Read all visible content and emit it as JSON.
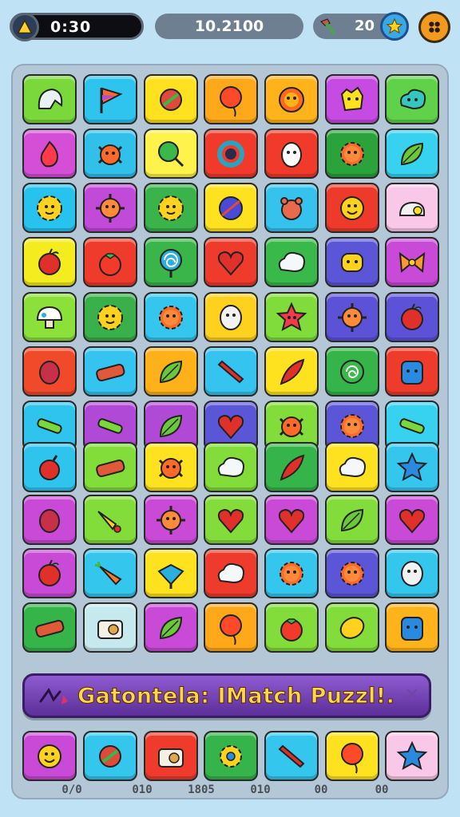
{
  "hud": {
    "timer": "0:30",
    "score": "10.2100",
    "moves": "20"
  },
  "banner": {
    "text": "Gatontela: IMatch Puzzl!."
  },
  "board": {
    "rows": [
      [
        {
          "color": "#7ad83a",
          "icon": "ghost-icon"
        },
        {
          "color": "#2fc4ee",
          "icon": "flag-icon"
        },
        {
          "color": "#ffe11f",
          "icon": "candy-icon"
        },
        {
          "color": "#ffa91a",
          "icon": "balloon-icon"
        },
        {
          "color": "#ffb31a",
          "icon": "sun-icon"
        },
        {
          "color": "#c64be2",
          "icon": "cat-icon"
        },
        {
          "color": "#5fd24a",
          "icon": "cloud-face-icon"
        }
      ],
      [
        {
          "color": "#d44fd6",
          "icon": "flame-icon"
        },
        {
          "color": "#31c0ea",
          "icon": "crab-icon"
        },
        {
          "color": "#fff24a",
          "icon": "lollipop-icon"
        },
        {
          "color": "#f23a2a",
          "icon": "wreath-icon"
        },
        {
          "color": "#f23a2a",
          "icon": "egg-icon"
        },
        {
          "color": "#2aa33a",
          "icon": "gear-face-icon"
        },
        {
          "color": "#36d2f0",
          "icon": "leaf-icon"
        }
      ],
      [
        {
          "color": "#27c2ee",
          "icon": "sun-face-icon"
        },
        {
          "color": "#c24ad8",
          "icon": "virus-icon"
        },
        {
          "color": "#3ab34a",
          "icon": "sun-face-icon"
        },
        {
          "color": "#ffe21f",
          "icon": "ball-icon"
        },
        {
          "color": "#35c3ed",
          "icon": "bear-icon"
        },
        {
          "color": "#ee3a2a",
          "icon": "smiley-icon"
        },
        {
          "color": "#f9c8e8",
          "icon": "snail-icon"
        }
      ],
      [
        {
          "color": "#f4ec1e",
          "icon": "apple-icon"
        },
        {
          "color": "#ef3b2c",
          "icon": "tomato-icon"
        },
        {
          "color": "#3ab54a",
          "icon": "lollipop-spiral-icon"
        },
        {
          "color": "#ef3b2c",
          "icon": "heart-icon"
        },
        {
          "color": "#38b94a",
          "icon": "cloud-icon"
        },
        {
          "color": "#5b55d8",
          "icon": "cookie-icon"
        },
        {
          "color": "#c84ad6",
          "icon": "bow-icon"
        }
      ],
      [
        {
          "color": "#8ce03a",
          "icon": "mushroom-icon"
        },
        {
          "color": "#3ab04a",
          "icon": "sun-face-icon"
        },
        {
          "color": "#35c6ee",
          "icon": "gear-face-icon"
        },
        {
          "color": "#ffd11f",
          "icon": "ghost-face-icon"
        },
        {
          "color": "#7fdc3a",
          "icon": "star-face-icon"
        },
        {
          "color": "#5b52d8",
          "icon": "virus-icon"
        },
        {
          "color": "#5b52d8",
          "icon": "apple-icon"
        }
      ],
      [
        {
          "color": "#f14a2a",
          "icon": "plum-icon"
        },
        {
          "color": "#35c3ef",
          "icon": "bar-icon"
        },
        {
          "color": "#ffb11a",
          "icon": "leaf-icon"
        },
        {
          "color": "#35c3ef",
          "icon": "crayon-icon"
        },
        {
          "color": "#ffe21f",
          "icon": "feather-icon"
        },
        {
          "color": "#34b449",
          "icon": "swirl-icon"
        },
        {
          "color": "#ef3b2c",
          "icon": "monster-icon"
        }
      ],
      [
        {
          "color": "#2fc4ee",
          "icon": "bone-icon"
        },
        {
          "color": "#b04ad6",
          "icon": "bone-icon"
        },
        {
          "color": "#b04ad6",
          "icon": "leaf-icon"
        },
        {
          "color": "#5b55d8",
          "icon": "heart-icon"
        },
        {
          "color": "#82dc3a",
          "icon": "crab-icon"
        },
        {
          "color": "#5b55d8",
          "icon": "gear-face-icon"
        },
        {
          "color": "#36d2f0",
          "icon": "bone-icon"
        }
      ],
      [
        {
          "color": "#2fc4ee",
          "icon": "bomb-icon"
        },
        {
          "color": "#82dc3a",
          "icon": "bar-icon"
        },
        {
          "color": "#ffe21f",
          "icon": "crab-icon"
        },
        {
          "color": "#82dc3a",
          "icon": "cloud-icon"
        },
        {
          "color": "#34b449",
          "icon": "feather-icon"
        },
        {
          "color": "#ffe21f",
          "icon": "cloud-icon"
        },
        {
          "color": "#35c6ee",
          "icon": "star-icon"
        }
      ],
      [
        {
          "color": "#c84ad6",
          "icon": "plum-icon"
        },
        {
          "color": "#82dc3a",
          "icon": "horn-icon"
        },
        {
          "color": "#c84ad6",
          "icon": "virus-icon"
        },
        {
          "color": "#82dc3a",
          "icon": "heart-icon"
        },
        {
          "color": "#c84ad6",
          "icon": "heart-icon"
        },
        {
          "color": "#82dc3a",
          "icon": "leaf-icon"
        },
        {
          "color": "#c84ad6",
          "icon": "heart-icon"
        }
      ],
      [
        {
          "color": "#c84ad6",
          "icon": "apple-icon"
        },
        {
          "color": "#35c6ee",
          "icon": "carrot-icon"
        },
        {
          "color": "#ffe21f",
          "icon": "top-icon"
        },
        {
          "color": "#ef3b2c",
          "icon": "cloud-icon"
        },
        {
          "color": "#35c6ee",
          "icon": "gear-face-icon"
        },
        {
          "color": "#5b55d8",
          "icon": "gear-face-icon"
        },
        {
          "color": "#35c6ee",
          "icon": "ghost-face-icon"
        }
      ],
      [
        {
          "color": "#34b449",
          "icon": "bar-icon"
        },
        {
          "color": "#c6e9ee",
          "icon": "camera-icon"
        },
        {
          "color": "#c84ad6",
          "icon": "leaf-icon"
        },
        {
          "color": "#ffa91a",
          "icon": "balloon-icon"
        },
        {
          "color": "#82dc3a",
          "icon": "tomato-icon"
        },
        {
          "color": "#82dc3a",
          "icon": "lemon-icon"
        },
        {
          "color": "#ffb31a",
          "icon": "monster-icon"
        }
      ],
      [
        {
          "color": "#c84ad6",
          "icon": "smiley-icon"
        },
        {
          "color": "#35c6ee",
          "icon": "candy-icon"
        },
        {
          "color": "#ef3b2c",
          "icon": "camera-icon"
        },
        {
          "color": "#34b449",
          "icon": "gear-icon"
        },
        {
          "color": "#35c6ee",
          "icon": "crayon-icon"
        },
        {
          "color": "#ffe21f",
          "icon": "balloon-icon"
        },
        {
          "color": "#f9c8e8",
          "icon": "star-icon"
        }
      ]
    ]
  },
  "bottom_labels": [
    "0/0",
    "010",
    "1805",
    "010",
    "00",
    "00"
  ]
}
